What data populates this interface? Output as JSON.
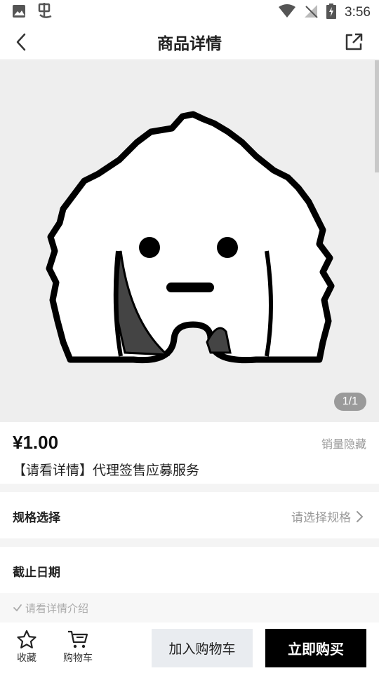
{
  "status_bar": {
    "time": "3:56"
  },
  "nav": {
    "title": "商品详情"
  },
  "gallery": {
    "counter": "1/1"
  },
  "product": {
    "price": "¥1.00",
    "sales": "销量隐藏",
    "name": "【请看详情】代理签售应募服务"
  },
  "spec": {
    "label": "规格选择",
    "value": "请选择规格"
  },
  "deadline": {
    "label": "截止日期"
  },
  "notice": {
    "text": "请看详情介绍"
  },
  "bottom_bar": {
    "favorite_label": "收藏",
    "cart_label": "购物车",
    "add_to_cart": "加入购物车",
    "buy_now": "立即购买"
  },
  "colors": {
    "buy_button": "#000000",
    "add_button": "#e9ecf0",
    "muted_text": "#999999"
  }
}
